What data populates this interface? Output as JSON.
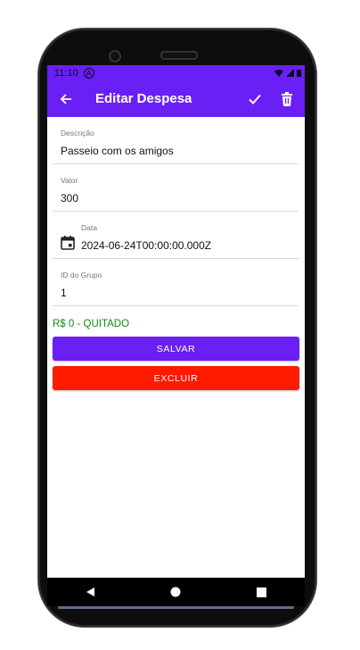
{
  "status_bar": {
    "time": "11:10",
    "notif_letter": "A"
  },
  "app_bar": {
    "title": "Editar Despesa",
    "back_icon": "arrow-left-icon",
    "save_icon": "check-icon",
    "delete_icon": "trash-icon"
  },
  "form": {
    "descricao": {
      "label": "Descrição",
      "value": "Passeio com os amigos"
    },
    "valor": {
      "label": "Valor",
      "value": "300"
    },
    "data": {
      "label": "Data",
      "value": "2024-06-24T00:00:00.000Z",
      "icon": "calendar-icon"
    },
    "grupo": {
      "label": "ID do Grupo",
      "value": "1"
    }
  },
  "status_text": "R$ 0 - QUITADO",
  "buttons": {
    "save": "SALVAR",
    "delete": "EXCLUIR"
  },
  "colors": {
    "primary": "#6a1ff5",
    "danger": "#ff1a00",
    "success": "#118a11"
  }
}
